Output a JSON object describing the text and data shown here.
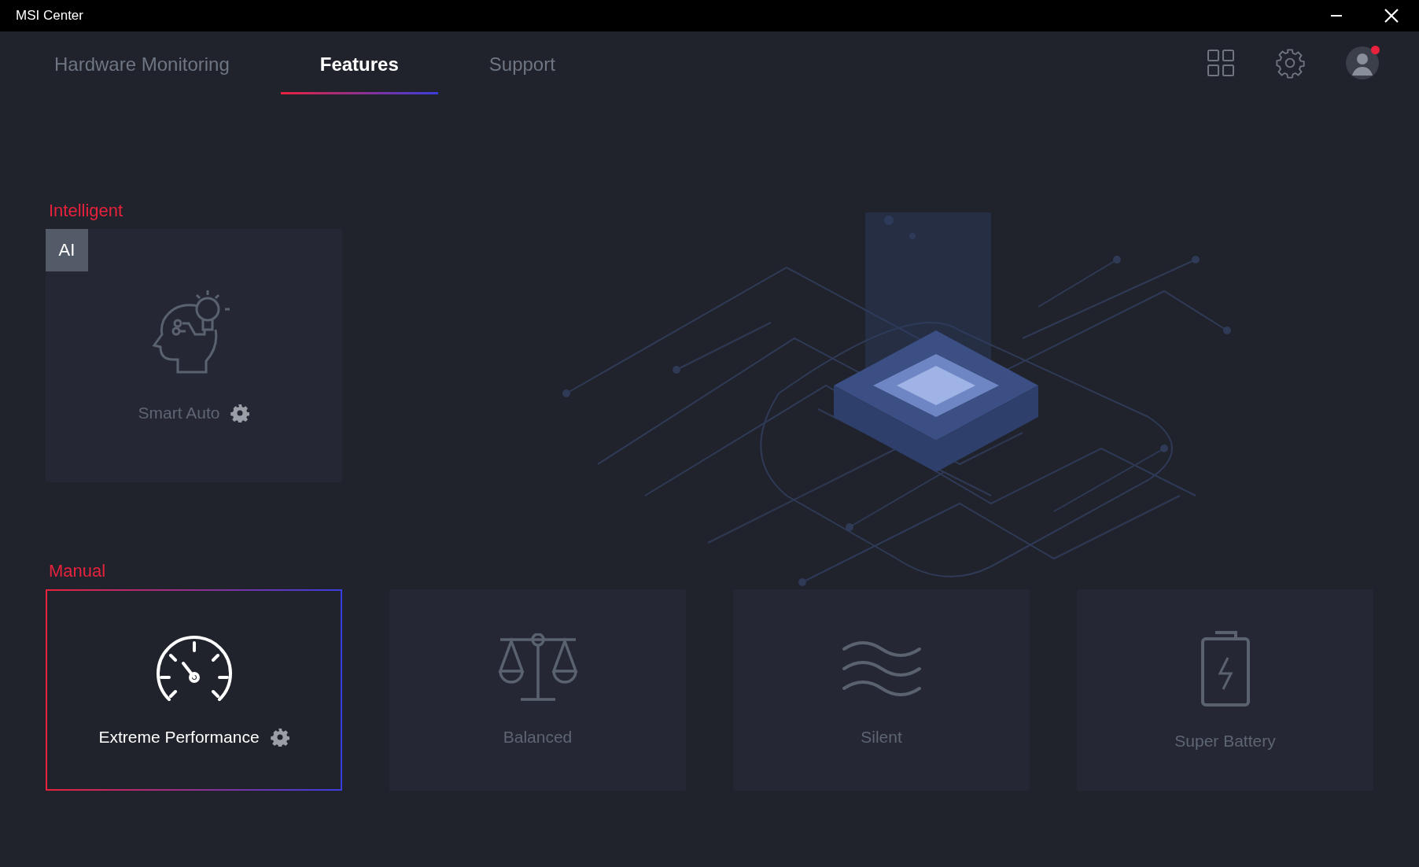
{
  "window": {
    "title": "MSI Center"
  },
  "tabs": [
    {
      "label": "Hardware Monitoring",
      "selected": false
    },
    {
      "label": "Features",
      "selected": true
    },
    {
      "label": "Support",
      "selected": false
    }
  ],
  "profile": {
    "notification": true
  },
  "sections": [
    {
      "title": "Intelligent",
      "cards": [
        {
          "kind": "brain",
          "label": "Smart Auto",
          "badge": "AI",
          "settings": true,
          "selected": false
        }
      ]
    },
    {
      "title": "Manual",
      "cards": [
        {
          "kind": "gauge",
          "label": "Extreme Performance",
          "settings": true,
          "selected": true
        },
        {
          "kind": "scale",
          "label": "Balanced",
          "settings": false,
          "selected": false
        },
        {
          "kind": "waves",
          "label": "Silent",
          "settings": false,
          "selected": false
        },
        {
          "kind": "battery",
          "label": "Super Battery",
          "settings": false,
          "selected": false
        }
      ]
    }
  ]
}
